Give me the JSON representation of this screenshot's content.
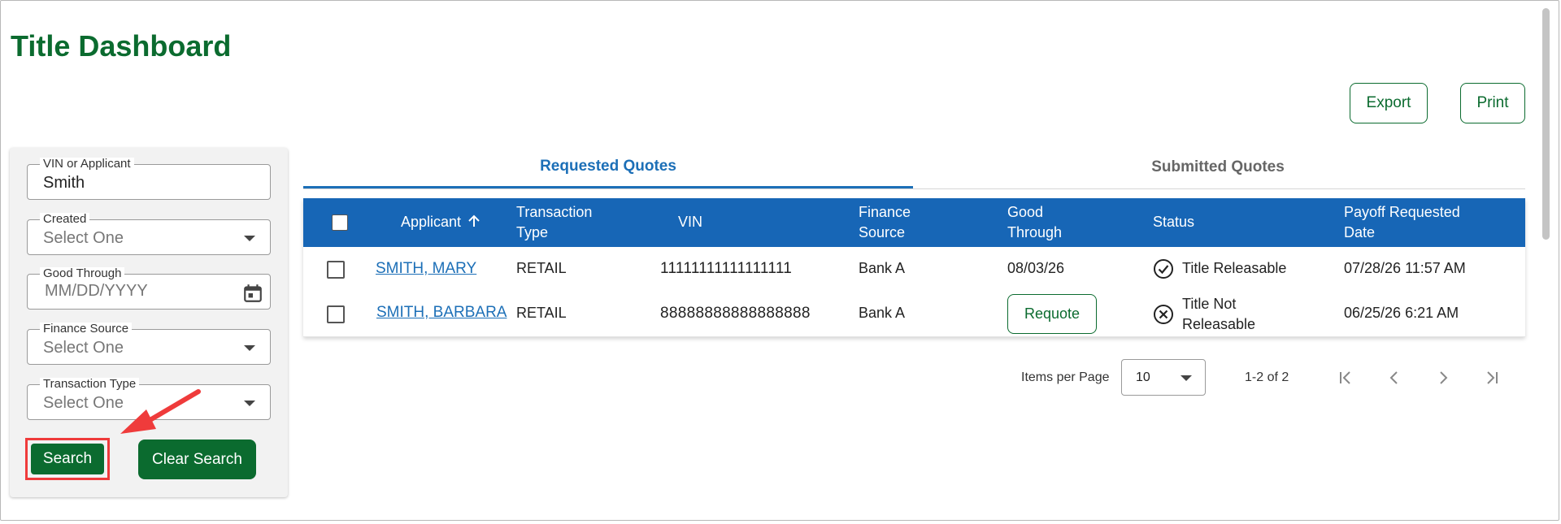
{
  "page": {
    "title": "Title Dashboard",
    "accent_color": "#0b6b2f",
    "header_color": "#1766b6",
    "link_color": "#1c6fb7"
  },
  "actions": {
    "export_label": "Export",
    "print_label": "Print"
  },
  "filters": {
    "vin": {
      "label": "VIN or Applicant",
      "value": "Smith"
    },
    "created": {
      "label": "Created",
      "value": "Select One"
    },
    "good_through": {
      "label": "Good Through",
      "placeholder": "MM/DD/YYYY",
      "icon": "calendar-icon"
    },
    "finance_source": {
      "label": "Finance Source",
      "value": "Select One"
    },
    "transaction_type": {
      "label": "Transaction Type",
      "value": "Select One"
    },
    "search_label": "Search",
    "clear_label": "Clear Search",
    "highlight_color": "#ef3b3b"
  },
  "tabs": [
    {
      "label": "Requested Quotes",
      "active": true
    },
    {
      "label": "Submitted Quotes",
      "active": false
    }
  ],
  "table": {
    "columns": {
      "applicant": "Applicant",
      "transaction_type": [
        "Transaction",
        "Type"
      ],
      "vin": "VIN",
      "finance_source": [
        "Finance",
        "Source"
      ],
      "good_through": [
        "Good",
        "Through"
      ],
      "status": "Status",
      "payoff_date": [
        "Payoff Requested",
        "Date"
      ]
    },
    "sort_icon": "arrow-up-icon",
    "rows": [
      {
        "applicant": "SMITH, MARY",
        "transaction_type": "RETAIL",
        "vin": "11111111111111111",
        "finance_source": "Bank A",
        "good_through": "08/03/26",
        "status": [
          "Title Releasable"
        ],
        "status_icon": "check-circle-icon",
        "payoff_date": "07/28/26 11:57 AM"
      },
      {
        "applicant": "SMITH, BARBARA",
        "transaction_type": "RETAIL",
        "vin": "88888888888888888",
        "finance_source": "Bank A",
        "good_through_action": "Requote",
        "status": [
          "Title Not",
          "Releasable"
        ],
        "status_icon": "x-circle-icon",
        "payoff_date": "06/25/26 6:21 AM"
      }
    ]
  },
  "pagination": {
    "items_per_page_label": "Items per Page",
    "items_per_page": "10",
    "range": "1-2 of 2"
  }
}
